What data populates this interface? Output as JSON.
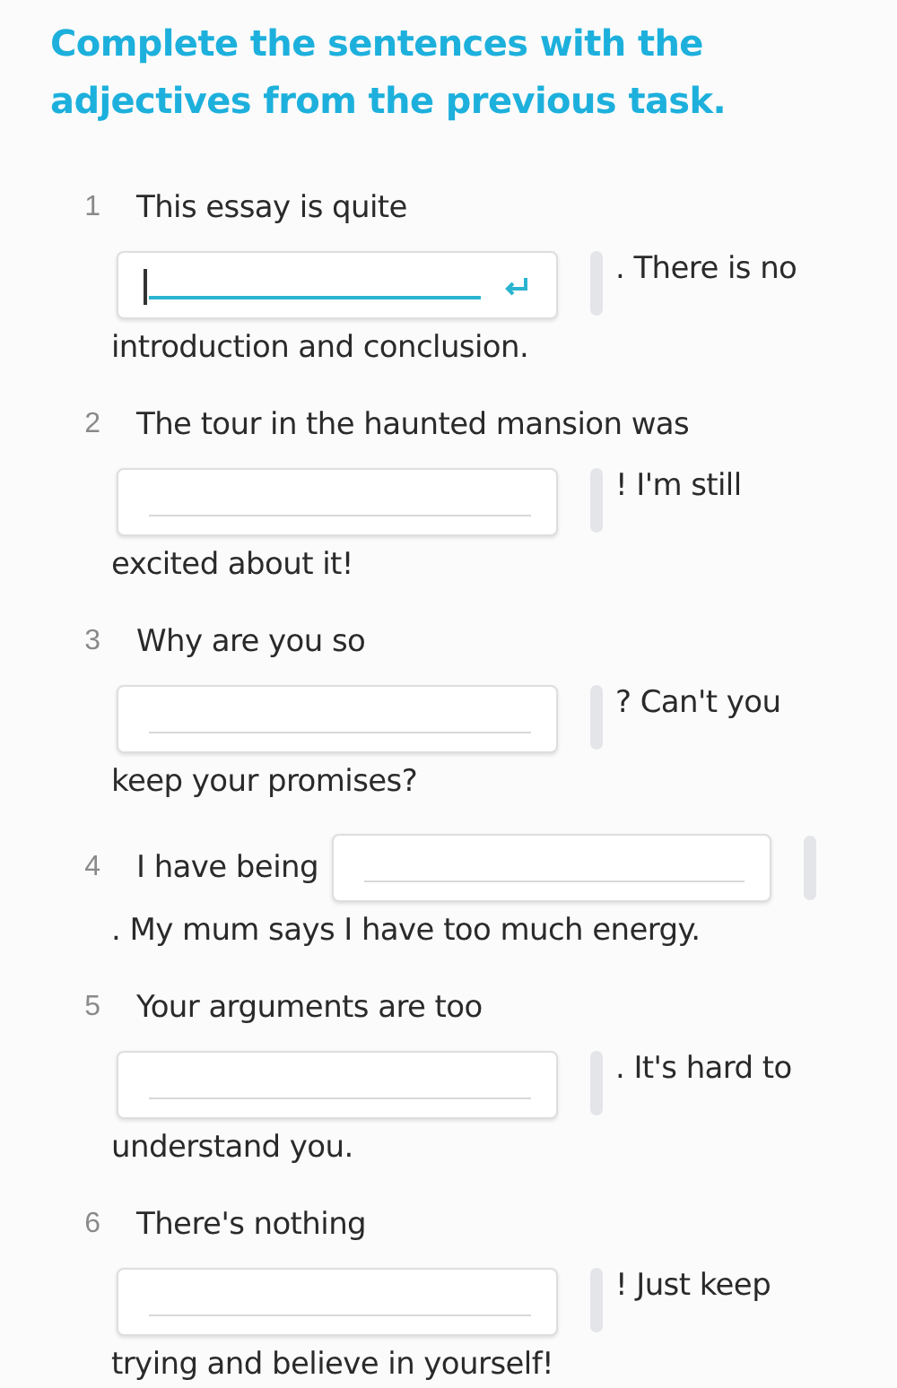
{
  "title": "Complete the sentences with the adjectives from the previous task.",
  "items": [
    {
      "number": "1",
      "kind": "break",
      "before": "This essay is quite",
      "focused": true,
      "after": ". There is no",
      "rest": "introduction and conclusion."
    },
    {
      "number": "2",
      "kind": "break",
      "before": "The tour in the haunted mansion was",
      "focused": false,
      "after": "! I'm still",
      "rest": "excited about it!"
    },
    {
      "number": "3",
      "kind": "break",
      "before": "Why are you so",
      "focused": false,
      "after": "? Can't you",
      "rest": "keep your promises?"
    },
    {
      "number": "4",
      "kind": "inline",
      "before": "I have being",
      "focused": false,
      "after": ". My mum says I have too much energy."
    },
    {
      "number": "5",
      "kind": "break",
      "before": "Your arguments are too",
      "focused": false,
      "after": ". It's hard to",
      "rest": "understand you."
    },
    {
      "number": "6",
      "kind": "break",
      "before": "There's nothing",
      "focused": false,
      "after": "! Just keep",
      "rest": "trying and believe in yourself!"
    }
  ]
}
